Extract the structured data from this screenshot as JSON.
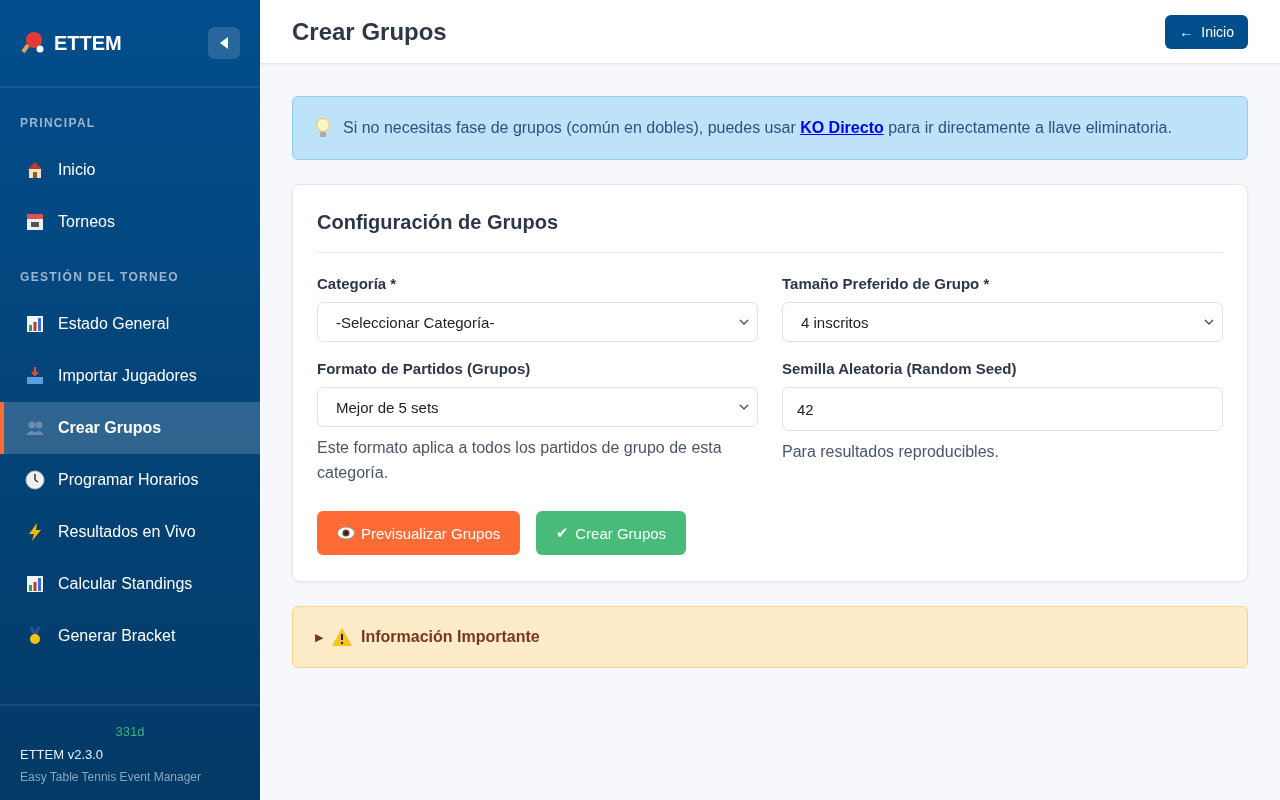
{
  "sidebar": {
    "brand": "ETTEM",
    "sections": [
      {
        "title": "PRINCIPAL",
        "items": [
          {
            "label": "Inicio",
            "selected": false
          },
          {
            "label": "Torneos",
            "selected": false
          }
        ]
      },
      {
        "title": "GESTIÓN DEL TORNEO",
        "items": [
          {
            "label": "Estado General",
            "selected": false
          },
          {
            "label": "Importar Jugadores",
            "selected": false
          },
          {
            "label": "Crear Grupos",
            "selected": true
          },
          {
            "label": "Programar Horarios",
            "selected": false
          },
          {
            "label": "Resultados en Vivo",
            "selected": false
          },
          {
            "label": "Calcular Standings",
            "selected": false
          },
          {
            "label": "Generar Bracket",
            "selected": false
          }
        ]
      }
    ],
    "footer": {
      "status": "331d",
      "version": "ETTEM v2.3.0",
      "tagline": "Easy Table Tennis Event Manager"
    }
  },
  "header": {
    "title": "Crear Grupos",
    "back_button": {
      "arrow": "←",
      "label": "Inicio"
    }
  },
  "notice": {
    "before": "Si no necesitas fase de grupos (común en dobles), puedes usar",
    "link": "KO Directo",
    "after": "para ir directamente a llave eliminatoria."
  },
  "form": {
    "title": "Configuración de Grupos",
    "fields": [
      {
        "kind": "select",
        "label": "Categoría *",
        "value": "-Seleccionar Categoría-"
      },
      {
        "kind": "select",
        "label": "Tamaño Preferido de Grupo *",
        "value": "4 inscritos"
      },
      {
        "kind": "select",
        "label": "Formato de Partidos (Grupos)",
        "value": "Mejor de 5 sets",
        "help": "Este formato aplica a todos los partidos de grupo de esta categoría."
      },
      {
        "kind": "input",
        "label": "Semilla Aleatoria (Random Seed)",
        "value": "42",
        "help": "Para resultados reproducibles."
      }
    ],
    "buttons": [
      {
        "kind": "preview",
        "label": "Previsualizar Grupos"
      },
      {
        "kind": "create",
        "mark": "✔",
        "label": "Crear Grupos"
      }
    ]
  },
  "details": {
    "marker": "▶",
    "title": "Información Importante",
    "expanded": false
  }
}
